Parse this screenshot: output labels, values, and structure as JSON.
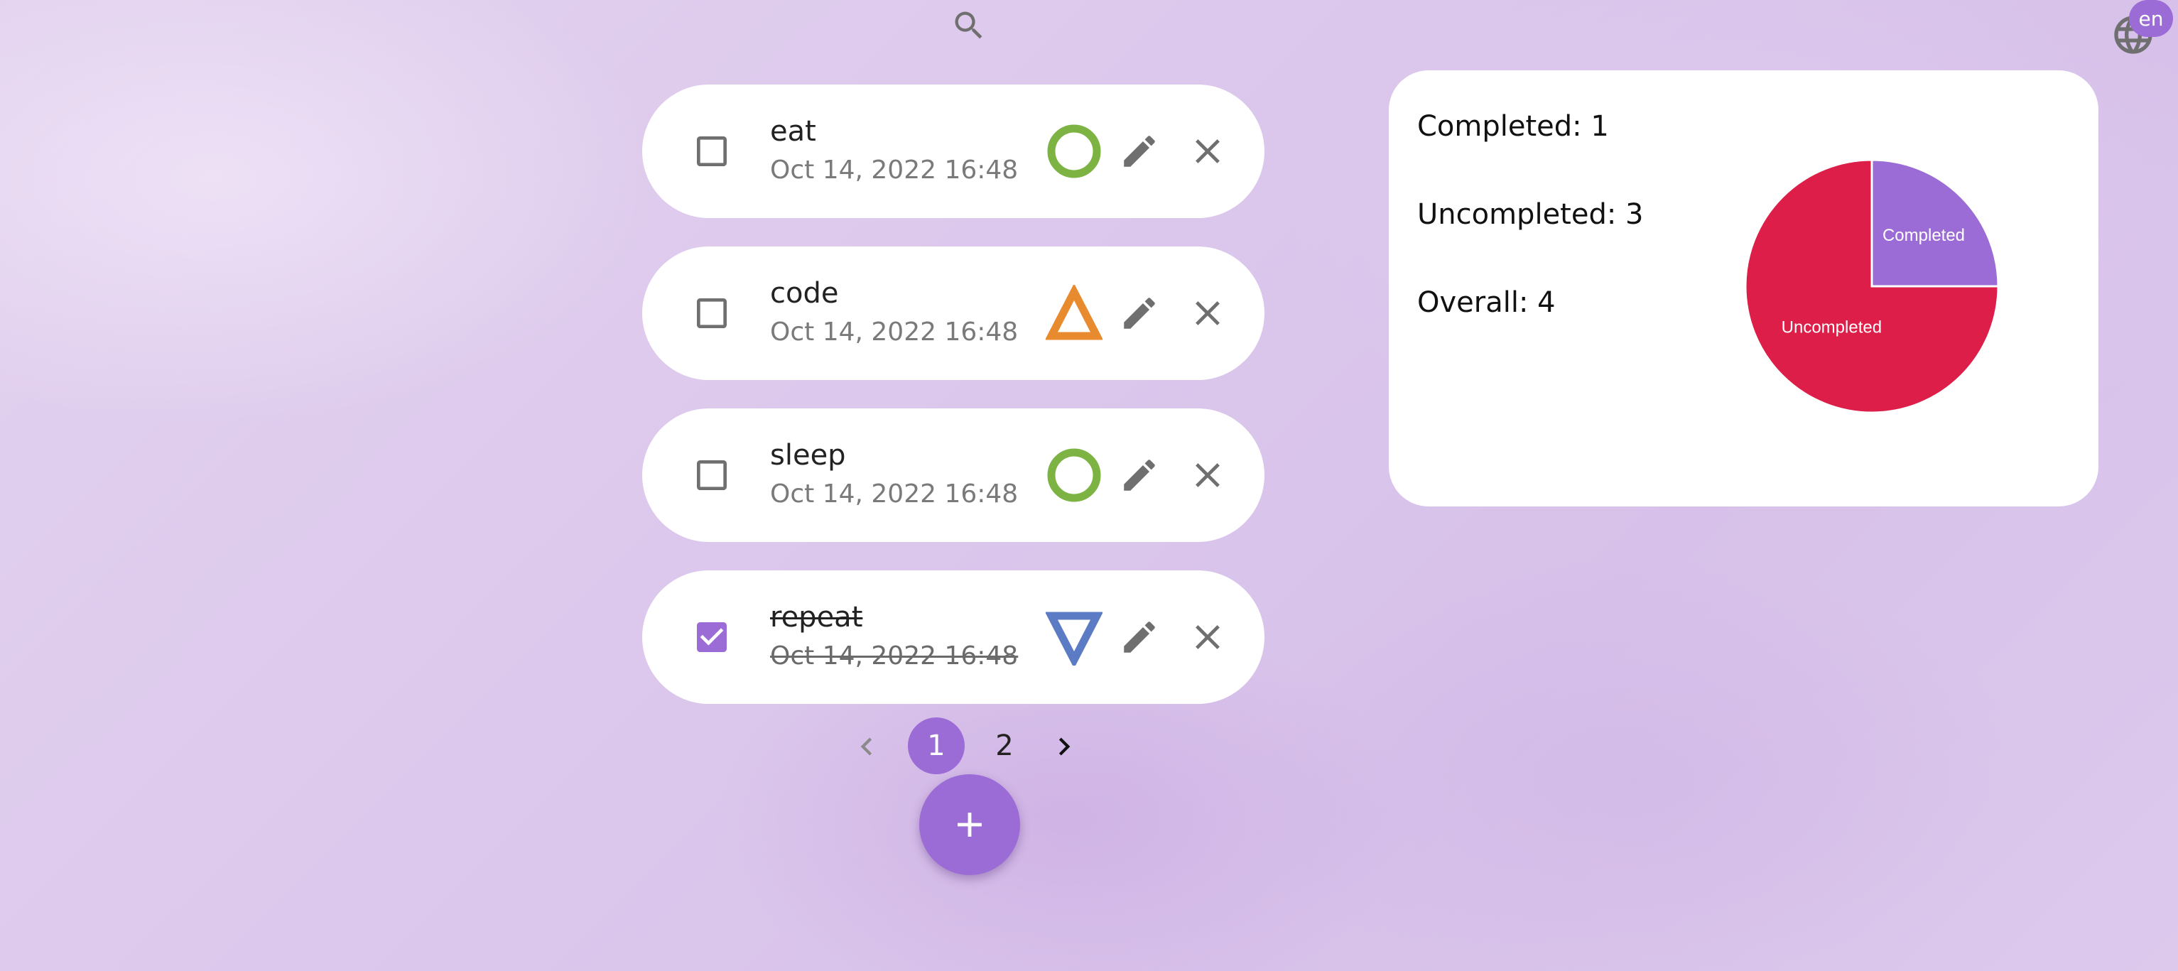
{
  "header": {
    "search_icon": "search-icon",
    "language_icon": "globe-icon",
    "language_code": "en"
  },
  "todos": [
    {
      "title": "eat",
      "date": "Oct 14, 2022 16:48",
      "completed": false,
      "priority_icon": "circle-icon",
      "priority_color": "#7cb342"
    },
    {
      "title": "code",
      "date": "Oct 14, 2022 16:48",
      "completed": false,
      "priority_icon": "triangle-up-icon",
      "priority_color": "#e88a2e"
    },
    {
      "title": "sleep",
      "date": "Oct 14, 2022 16:48",
      "completed": false,
      "priority_icon": "circle-icon",
      "priority_color": "#7cb342"
    },
    {
      "title": "repeat",
      "date": "Oct 14, 2022 16:48",
      "completed": true,
      "priority_icon": "triangle-down-icon",
      "priority_color": "#5b7cc4"
    }
  ],
  "pagination": {
    "pages": [
      "1",
      "2"
    ],
    "current": "1"
  },
  "stats": {
    "completed_text": "Completed: 1",
    "uncompleted_text": "Uncompleted: 3",
    "overall_text": "Overall: 4"
  },
  "chart_data": {
    "type": "pie",
    "categories": [
      "Completed",
      "Uncompleted"
    ],
    "values": [
      1,
      3
    ],
    "colors": [
      "#9b6bd6",
      "#dc1e48"
    ]
  },
  "colors": {
    "accent": "#9b6bd6",
    "icon_gray": "#6f6f6f"
  }
}
